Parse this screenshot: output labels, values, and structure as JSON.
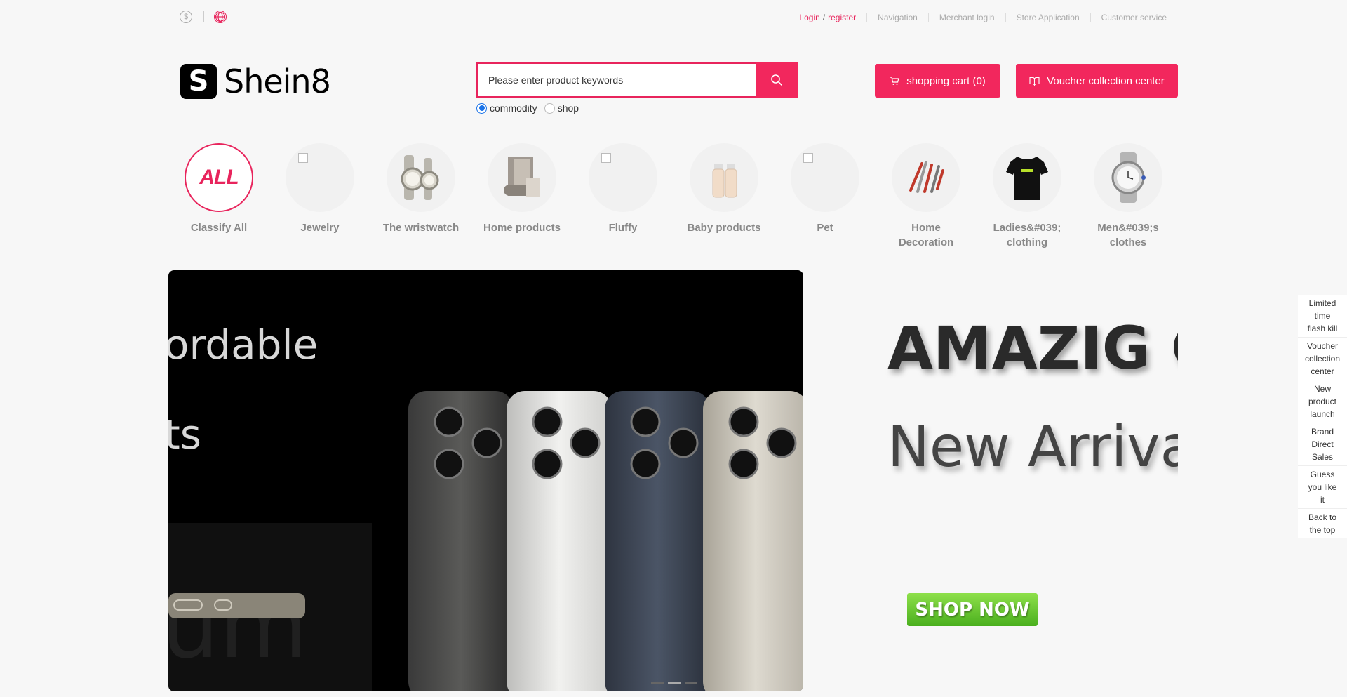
{
  "topbar": {
    "login": "Login",
    "slash": "/",
    "register": "register",
    "links": [
      "Navigation",
      "Merchant login",
      "Store Application",
      "Customer service"
    ]
  },
  "logo": {
    "mark": "S",
    "text": "Shein8"
  },
  "search": {
    "placeholder": "Please enter product keywords",
    "types": [
      "commodity",
      "shop"
    ],
    "selected": "commodity"
  },
  "header": {
    "cart_label": "shopping cart (0)",
    "voucher_label": "Voucher collection center"
  },
  "categories": [
    {
      "label": "Classify All",
      "image": "ALL"
    },
    {
      "label": "Jewelry"
    },
    {
      "label": "The wristwatch"
    },
    {
      "label": "Home products"
    },
    {
      "label": "Fluffy"
    },
    {
      "label": "Baby products"
    },
    {
      "label": "Pet"
    },
    {
      "label": "Home Decoration"
    },
    {
      "label": "Ladies&#039; clothing"
    },
    {
      "label": "Men&#039;s clothes"
    }
  ],
  "banner_left": {
    "line1": "ordable",
    "line2": "ts",
    "line3": "um"
  },
  "banner_right": {
    "line1": "AMAZIG  C",
    "line2": "New Arriva",
    "cta": "SHOP NOW"
  },
  "sidenav": [
    "Limited time flash kill",
    "Voucher collection center",
    "New product launch",
    "Brand Direct Sales",
    "Guess you like it",
    "Back to the top"
  ],
  "colors": {
    "accent": "#f2275d",
    "radio": "#1a73e8"
  }
}
